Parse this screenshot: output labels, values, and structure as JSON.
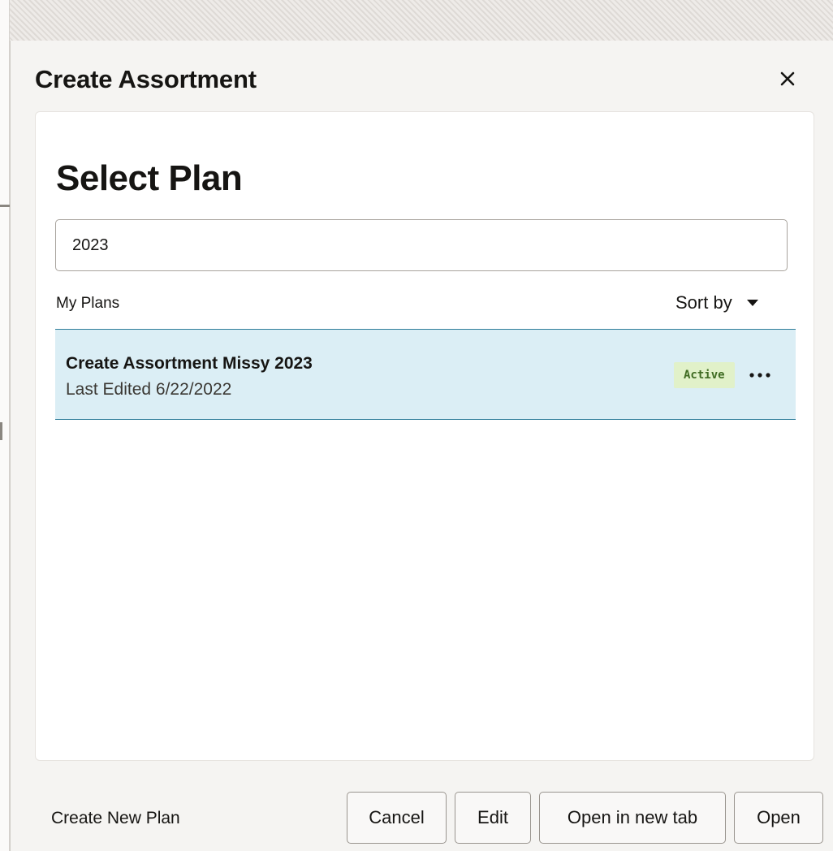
{
  "dialog": {
    "title": "Create Assortment",
    "close_icon": "close-icon"
  },
  "panel": {
    "heading": "Select Plan",
    "search": {
      "value": "2023",
      "placeholder": ""
    },
    "list": {
      "header": "My Plans",
      "sort_label": "Sort by",
      "sort_icon": "caret-down-icon",
      "items": [
        {
          "title": "Create Assortment Missy 2023",
          "subtitle": "Last Edited 6/22/2022",
          "status": "Active",
          "more_icon": "more-options-icon"
        }
      ]
    }
  },
  "footer": {
    "create_new": "Create New Plan",
    "cancel": "Cancel",
    "edit": "Edit",
    "open_new_tab": "Open in new tab",
    "open": "Open"
  },
  "colors": {
    "selected_row_bg": "#dbeef5",
    "selected_row_border": "#2e7d9a",
    "status_bg": "#e1f1c9",
    "status_text": "#3f6b22"
  }
}
